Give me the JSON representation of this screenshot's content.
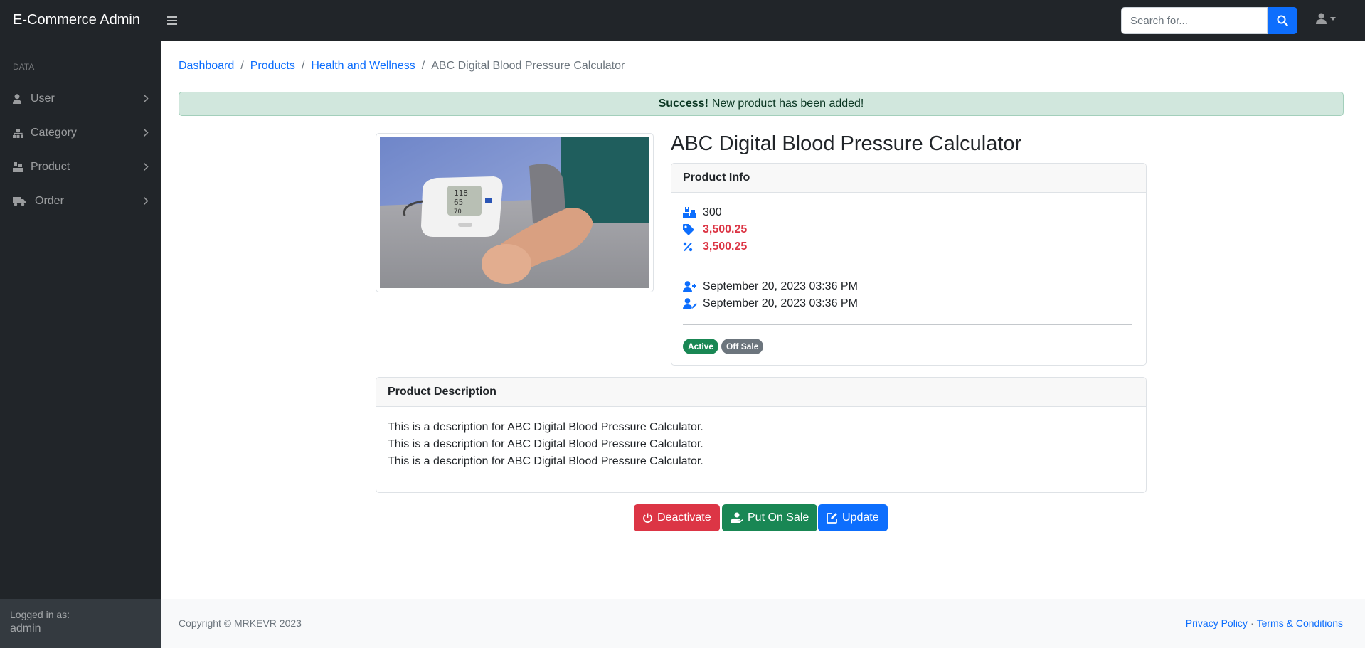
{
  "navbar": {
    "brand": "E-Commerce Admin",
    "search_placeholder": "Search for..."
  },
  "sidebar": {
    "heading": "DATA",
    "items": [
      {
        "label": "User",
        "icon": "user-icon"
      },
      {
        "label": "Category",
        "icon": "sitemap-icon"
      },
      {
        "label": "Product",
        "icon": "boxes-icon"
      },
      {
        "label": "Order",
        "icon": "truck-icon"
      }
    ],
    "footer": {
      "logged_in_label": "Logged in as:",
      "username": "admin"
    }
  },
  "breadcrumb": {
    "items": [
      "Dashboard",
      "Products",
      "Health and Wellness"
    ],
    "current": "ABC Digital Blood Pressure Calculator"
  },
  "alert": {
    "strong": "Success!",
    "message": "New product has been added!"
  },
  "product": {
    "title": "ABC Digital Blood Pressure Calculator",
    "info_header": "Product Info",
    "stock": "300",
    "price": "3,500.25",
    "sale_price": "3,500.25",
    "created_at": "September 20, 2023 03:36 PM",
    "updated_at": "September 20, 2023 03:36 PM",
    "badges": {
      "status": "Active",
      "sale": "Off Sale"
    }
  },
  "description": {
    "header": "Product Description",
    "lines": [
      "This is a description for ABC Digital Blood Pressure Calculator.",
      "This is a description for ABC Digital Blood Pressure Calculator.",
      "This is a description for ABC Digital Blood Pressure Calculator."
    ]
  },
  "actions": {
    "deactivate": "Deactivate",
    "put_on_sale": "Put On Sale",
    "update": "Update"
  },
  "footer": {
    "copyright": "Copyright © MRKEVR 2023",
    "privacy": "Privacy Policy",
    "separator": "·",
    "terms": "Terms & Conditions"
  },
  "colors": {
    "primary": "#0d6efd",
    "danger": "#dc3545",
    "success": "#198754",
    "secondary": "#6c757d",
    "dark": "#212529"
  }
}
